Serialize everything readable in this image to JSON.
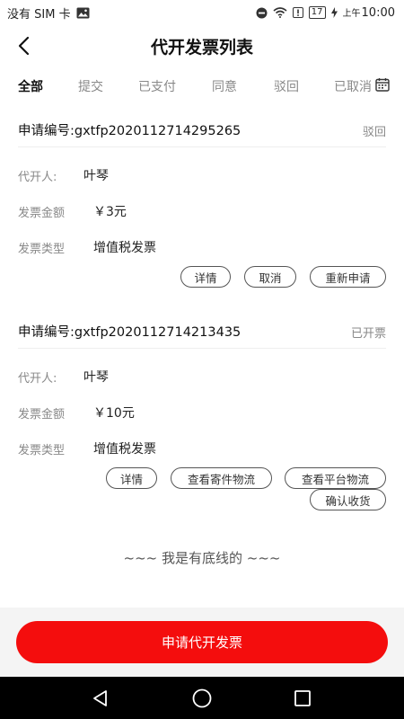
{
  "status_bar": {
    "carrier": "没有 SIM 卡",
    "battery_level": "17",
    "ampm": "上午",
    "time": "10:00",
    "icons": [
      "image-icon",
      "dnd-icon",
      "wifi-icon",
      "alert-icon",
      "battery-icon",
      "charging-icon"
    ]
  },
  "header": {
    "title": "代开发票列表",
    "back_icon": "back-chevron-icon"
  },
  "tabs": [
    {
      "label": "全部",
      "active": true
    },
    {
      "label": "提交",
      "active": false
    },
    {
      "label": "已支付",
      "active": false
    },
    {
      "label": "同意",
      "active": false
    },
    {
      "label": "驳回",
      "active": false
    },
    {
      "label": "已取消",
      "active": false
    }
  ],
  "calendar_icon": "calendar-icon",
  "orders": [
    {
      "apply_no": "申请编号:gxtfp2020112714295265",
      "status": "驳回",
      "agent_label": "代开人:",
      "agent_value": "叶琴",
      "amount_label": "发票金额",
      "amount_value": "￥3元",
      "type_label": "发票类型",
      "type_value": "增值税发票",
      "actions": [
        "详情",
        "取消",
        "重新申请"
      ]
    },
    {
      "apply_no": "申请编号:gxtfp2020112714213435",
      "status": "已开票",
      "agent_label": "代开人:",
      "agent_value": "叶琴",
      "amount_label": "发票金额",
      "amount_value": "￥10元",
      "type_label": "发票类型",
      "type_value": "增值税发票",
      "actions": [
        "详情",
        "查看寄件物流",
        "查看平台物流",
        "确认收货"
      ]
    }
  ],
  "bottom_text": "~~~ 我是有底线的 ~~~",
  "footer": {
    "apply_label": "申请代开发票",
    "accent_color": "#f40d0d"
  },
  "navbar": {
    "icons": [
      "nav-back-icon",
      "nav-home-icon",
      "nav-recents-icon"
    ]
  }
}
